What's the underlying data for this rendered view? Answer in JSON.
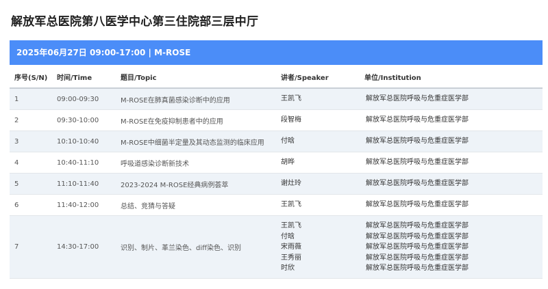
{
  "page": {
    "title": "解放军总医院第八医学中心第三住院部三层中厅"
  },
  "session": {
    "header": "2025年06月27日 09:00-17:00 | M-ROSE"
  },
  "table": {
    "columns": {
      "sn": "序号(S/N)",
      "time": "时间/Time",
      "topic": "题目/Topic",
      "speaker": "讲者/Speaker",
      "institution": "单位/Institution"
    },
    "rows": [
      {
        "sn": "1",
        "time": "09:00-09:30",
        "topic": "M-ROSE在肺真菌感染诊断中的应用",
        "speakers": [
          "王凯飞"
        ],
        "institutions": [
          "解放军总医院呼吸与危重症医学部"
        ]
      },
      {
        "sn": "2",
        "time": "09:30-10:00",
        "topic": "M-ROSE在免疫抑制患者中的应用",
        "speakers": [
          "段智梅"
        ],
        "institutions": [
          "解放军总医院呼吸与危重症医学部"
        ]
      },
      {
        "sn": "3",
        "time": "10:10-10:40",
        "topic": "M-ROSE中细菌半定量及其动态监测的临床应用",
        "speakers": [
          "付晗"
        ],
        "institutions": [
          "解放军总医院呼吸与危重症医学部"
        ]
      },
      {
        "sn": "4",
        "time": "10:40-11:10",
        "topic": "呼吸道感染诊断新技术",
        "speakers": [
          "胡晔"
        ],
        "institutions": [
          "解放军总医院呼吸与危重症医学部"
        ]
      },
      {
        "sn": "5",
        "time": "11:10-11:40",
        "topic": "2023-2024 M-ROSE经典病例荟萃",
        "speakers": [
          "谢灶玲"
        ],
        "institutions": [
          "解放军总医院呼吸与危重症医学部"
        ]
      },
      {
        "sn": "6",
        "time": "11:40-12:00",
        "topic": "总结、竞猜与答疑",
        "speakers": [
          "王凯飞"
        ],
        "institutions": [
          "解放军总医院呼吸与危重症医学部"
        ]
      },
      {
        "sn": "7",
        "time": "14:30-17:00",
        "topic": "识别、制片、革兰染色、diff染色、识别",
        "speakers": [
          "王凯飞",
          "付晗",
          "宋雨薇",
          "王秀丽",
          "时欣"
        ],
        "institutions": [
          "解放军总医院呼吸与危重症医学部",
          "解放军总医院呼吸与危重症医学部",
          "解放军总医院呼吸与危重症医学部",
          "解放军总医院呼吸与危重症医学部",
          "解放军总医院呼吸与危重症医学部"
        ]
      }
    ]
  }
}
